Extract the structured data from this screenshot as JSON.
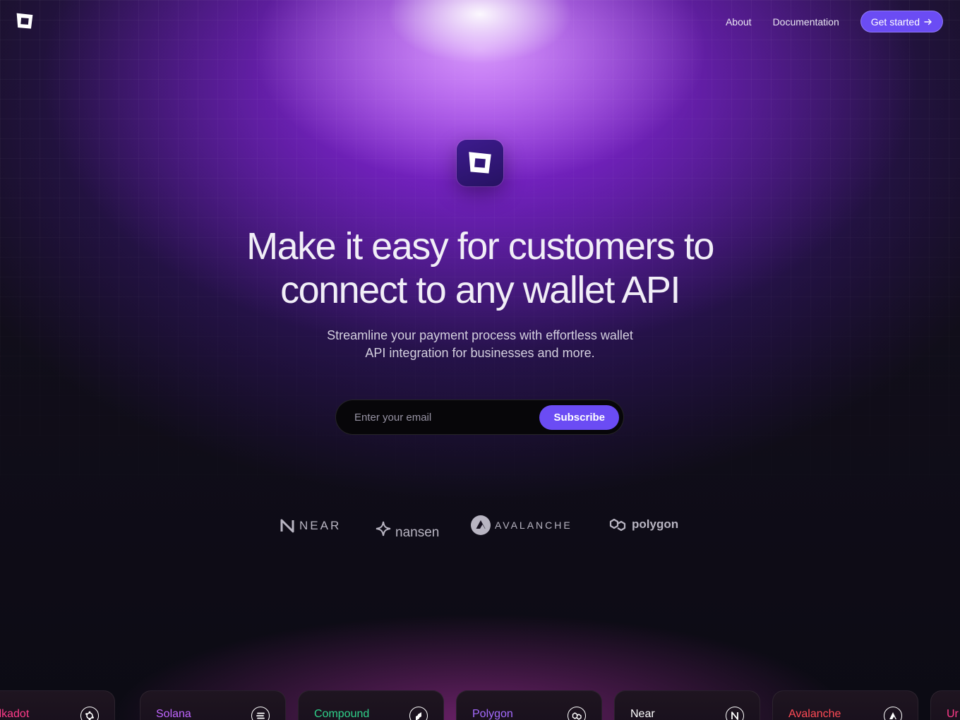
{
  "nav": {
    "links": [
      {
        "label": "About"
      },
      {
        "label": "Documentation"
      }
    ],
    "cta_label": "Get started"
  },
  "hero": {
    "title_line1": "Make it easy for customers to",
    "title_line2": "connect to any wallet API",
    "subtitle_line1": "Streamline your payment process with effortless wallet",
    "subtitle_line2": "API integration for businesses and more."
  },
  "subscribe": {
    "placeholder": "Enter your email",
    "value": "",
    "button_label": "Subscribe"
  },
  "partners": [
    {
      "name": "NEAR",
      "icon": "near-logo-icon"
    },
    {
      "name": "nansen",
      "icon": "nansen-logo-icon"
    },
    {
      "name": "AVALANCHE",
      "icon": "avalanche-logo-icon"
    },
    {
      "name": "polygon",
      "icon": "polygon-logo-icon"
    }
  ],
  "cards": [
    {
      "name": "Polkadot",
      "color": "#ff3b8a",
      "icon": "polkadot-icon"
    },
    {
      "name": "Solana",
      "color": "#c066ff",
      "icon": "solana-icon"
    },
    {
      "name": "Compound",
      "color": "#2fd18a",
      "icon": "compound-icon"
    },
    {
      "name": "Polygon",
      "color": "#a56bff",
      "icon": "polygon-icon"
    },
    {
      "name": "Near",
      "color": "#ffffff",
      "icon": "near-icon"
    },
    {
      "name": "Avalanche",
      "color": "#ff4a55",
      "icon": "avalanche-icon"
    },
    {
      "name": "Ur",
      "color": "#ff3b8a",
      "icon": ""
    }
  ],
  "colors": {
    "accent": "#6b4cf4",
    "background": "#0d0b16",
    "glow": "#9628e6"
  }
}
